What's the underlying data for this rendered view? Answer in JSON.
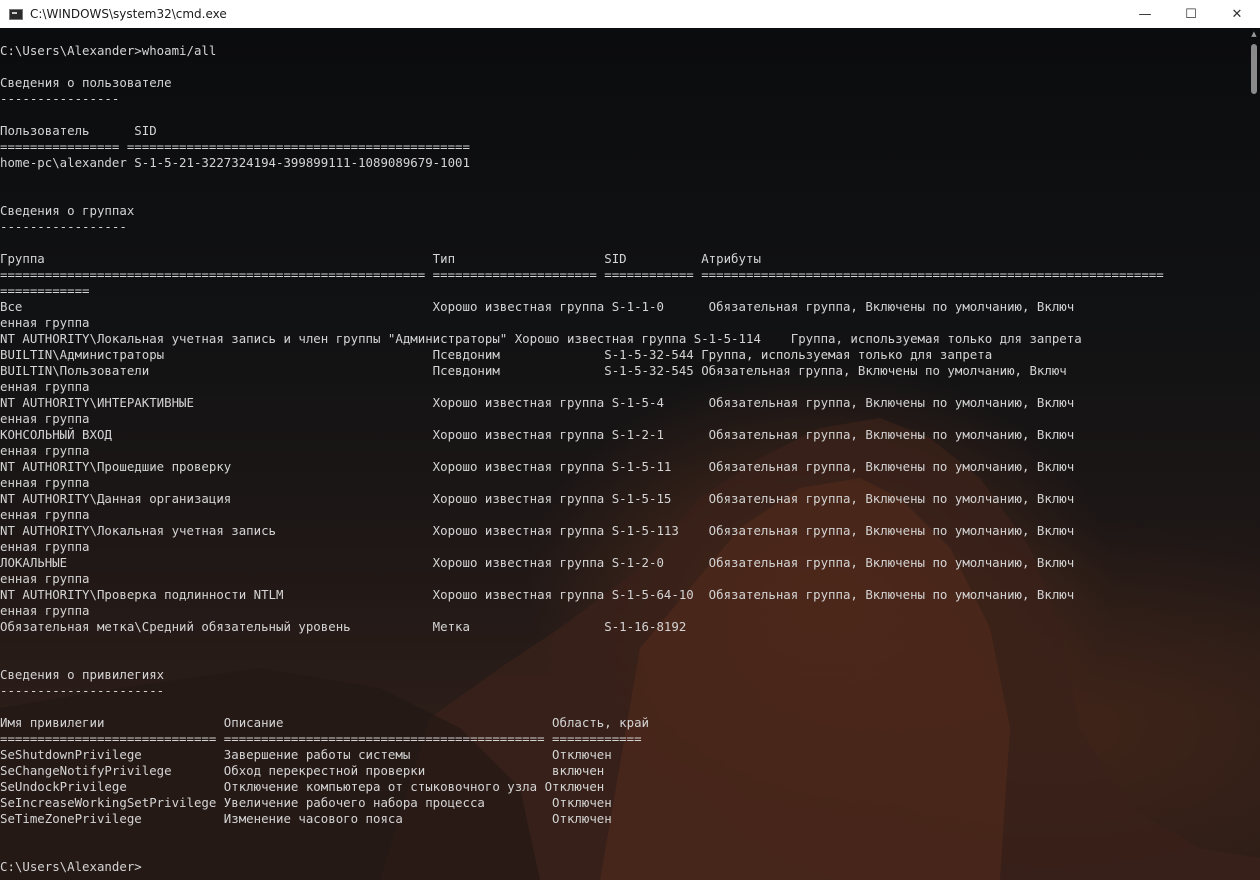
{
  "window": {
    "title": "C:\\WINDOWS\\system32\\cmd.exe",
    "icon": "console-icon",
    "controls": {
      "minimize": "—",
      "maximize": "☐",
      "close": "✕"
    }
  },
  "terminal": {
    "lines": [
      "C:\\Users\\Alexander>whoami/all",
      "",
      "Сведения о пользователе",
      "----------------",
      "",
      "Пользователь      SID",
      "================ ==============================================",
      "home-pc\\alexander S-1-5-21-3227324194-399899111-1089089679-1001",
      "",
      "",
      "Сведения о группах",
      "-----------------",
      "",
      "Группа                                                    Тип                    SID          Атрибуты",
      "========================================================= ====================== ============ ==============================================================",
      "============",
      "Все                                                       Хорошо известная группа S-1-1-0      Обязательная группа, Включены по умолчанию, Включ",
      "енная группа",
      "NT AUTHORITY\\Локальная учетная запись и член группы \"Администраторы\" Хорошо известная группа S-1-5-114    Группа, используемая только для запрета",
      "BUILTIN\\Администраторы                                    Псевдоним              S-1-5-32-544 Группа, используемая только для запрета",
      "BUILTIN\\Пользователи                                      Псевдоним              S-1-5-32-545 Обязательная группа, Включены по умолчанию, Включ",
      "енная группа",
      "NT AUTHORITY\\ИНТЕРАКТИВНЫЕ                                Хорошо известная группа S-1-5-4      Обязательная группа, Включены по умолчанию, Включ",
      "енная группа",
      "КОНСОЛЬНЫЙ ВХОД                                           Хорошо известная группа S-1-2-1      Обязательная группа, Включены по умолчанию, Включ",
      "енная группа",
      "NT AUTHORITY\\Прошедшие проверку                           Хорошо известная группа S-1-5-11     Обязательная группа, Включены по умолчанию, Включ",
      "енная группа",
      "NT AUTHORITY\\Данная организация                           Хорошо известная группа S-1-5-15     Обязательная группа, Включены по умолчанию, Включ",
      "енная группа",
      "NT AUTHORITY\\Локальная учетная запись                     Хорошо известная группа S-1-5-113    Обязательная группа, Включены по умолчанию, Включ",
      "енная группа",
      "ЛОКАЛЬНЫЕ                                                 Хорошо известная группа S-1-2-0      Обязательная группа, Включены по умолчанию, Включ",
      "енная группа",
      "NT AUTHORITY\\Проверка подлинности NTLM                    Хорошо известная группа S-1-5-64-10  Обязательная группа, Включены по умолчанию, Включ",
      "енная группа",
      "Обязательная метка\\Средний обязательный уровень           Метка                  S-1-16-8192",
      "",
      "",
      "Сведения о привилегиях",
      "----------------------",
      "",
      "Имя привилегии                Описание                                    Область, край",
      "============================= =========================================== ============",
      "SeShutdownPrivilege           Завершение работы системы                   Отключен",
      "SeChangeNotifyPrivilege       Обход перекрестной проверки                 включен",
      "SeUndockPrivilege             Отключение компьютера от стыковочного узла Отключен",
      "SeIncreaseWorkingSetPrivilege Увеличение рабочего набора процесса         Отключен",
      "SeTimeZonePrivilege           Изменение часового пояса                    Отключен",
      "",
      "",
      "C:\\Users\\Alexander>"
    ]
  }
}
